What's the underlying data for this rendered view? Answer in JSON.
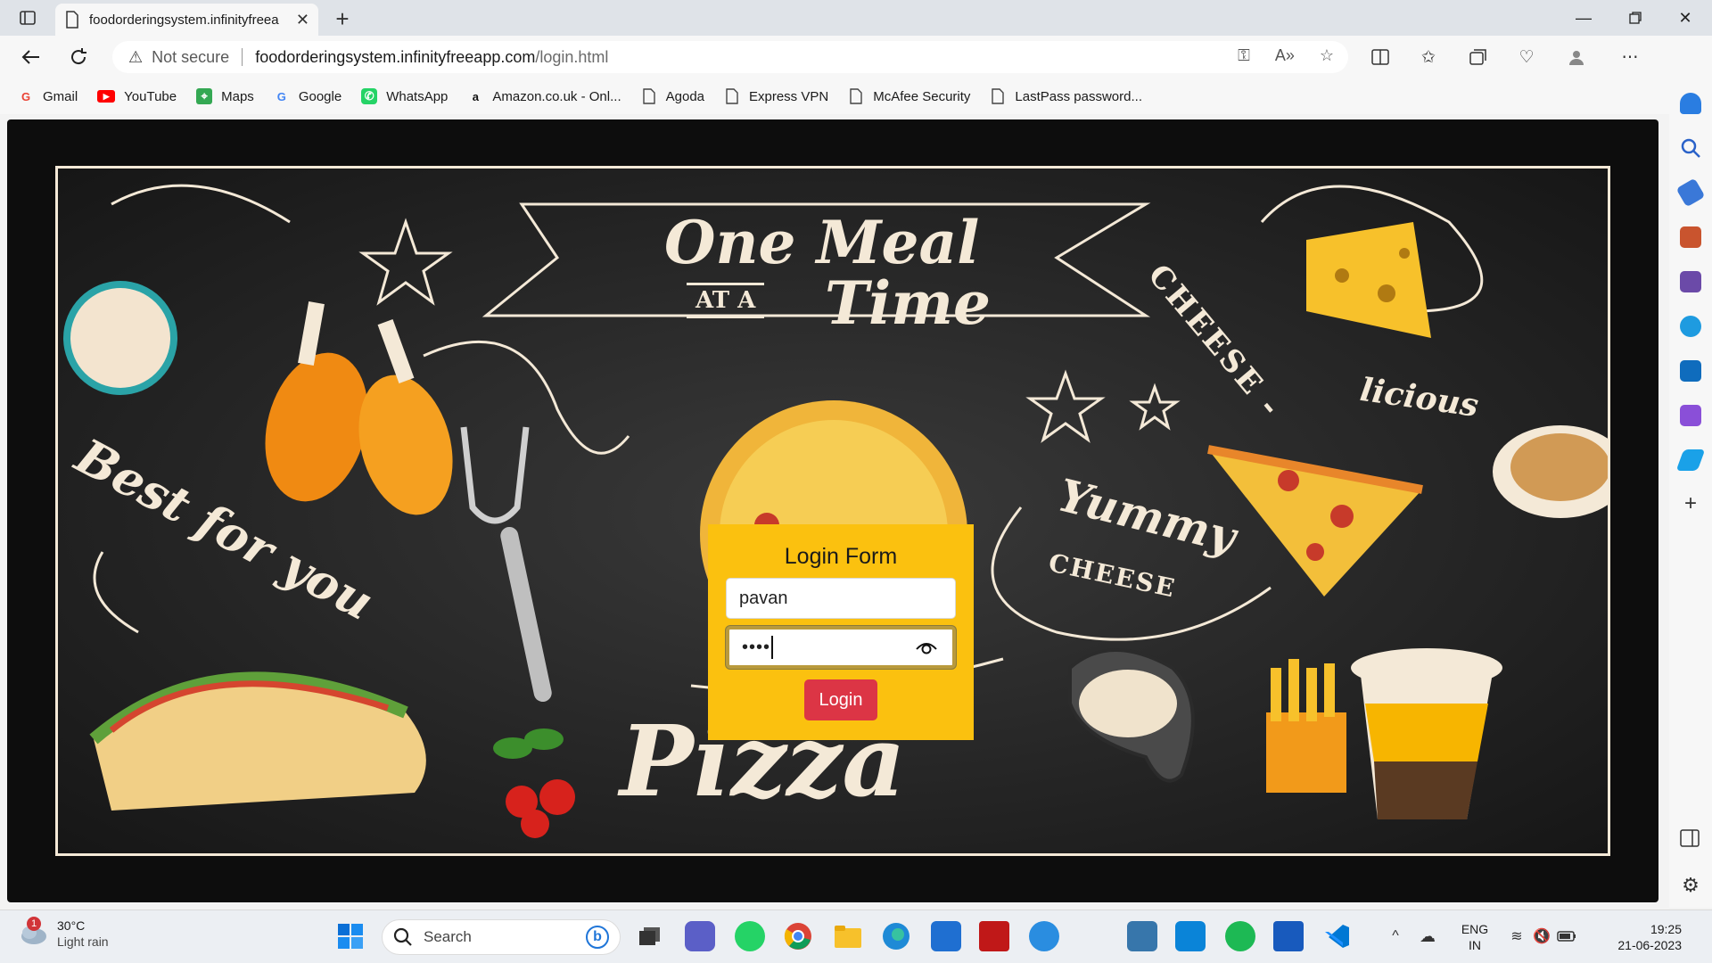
{
  "browser": {
    "tab_title": "foodorderingsystem.infinityfreea",
    "new_tab_symbol": "+",
    "security_label": "Not secure",
    "url_host": "foodorderingsystem.infinityfreeapp.com",
    "url_path": "/login.html"
  },
  "bookmarks": [
    {
      "label": "Gmail",
      "icon": "gmail-icon",
      "color": "#ea4335"
    },
    {
      "label": "YouTube",
      "icon": "youtube-icon",
      "color": "#ff0000"
    },
    {
      "label": "Maps",
      "icon": "maps-icon",
      "color": "#34a853"
    },
    {
      "label": "Google",
      "icon": "google-icon",
      "color": "#4285f4"
    },
    {
      "label": "WhatsApp",
      "icon": "whatsapp-icon",
      "color": "#25d366"
    },
    {
      "label": "Amazon.co.uk - Onl...",
      "icon": "amazon-icon",
      "color": "#111111"
    },
    {
      "label": "Agoda",
      "icon": "page-icon",
      "color": "#555555"
    },
    {
      "label": "Express VPN",
      "icon": "page-icon",
      "color": "#555555"
    },
    {
      "label": "McAfee Security",
      "icon": "page-icon",
      "color": "#555555"
    },
    {
      "label": "LastPass password...",
      "icon": "page-icon",
      "color": "#555555"
    }
  ],
  "poster": {
    "line1": "One Meal",
    "line2_small": "AT A",
    "line2": "Time",
    "cheese": "CHEESE -",
    "licious": "licious",
    "best": "Best for you",
    "yummy": "Yummy",
    "yummy_cheese": "CHEESE",
    "pizza": "Pizza"
  },
  "login": {
    "title": "Login Form",
    "username": "pavan",
    "password_masked": "••••",
    "button": "Login"
  },
  "taskbar": {
    "weather_temp": "30°C",
    "weather_cond": "Light rain",
    "weather_badge": "1",
    "search_label": "Search",
    "lang_top": "ENG",
    "lang_bottom": "IN",
    "time": "19:25",
    "date": "21-06-2023"
  },
  "colors": {
    "card": "#fbc10f",
    "button": "#dc3545",
    "chalk": "#f4e9d7"
  }
}
